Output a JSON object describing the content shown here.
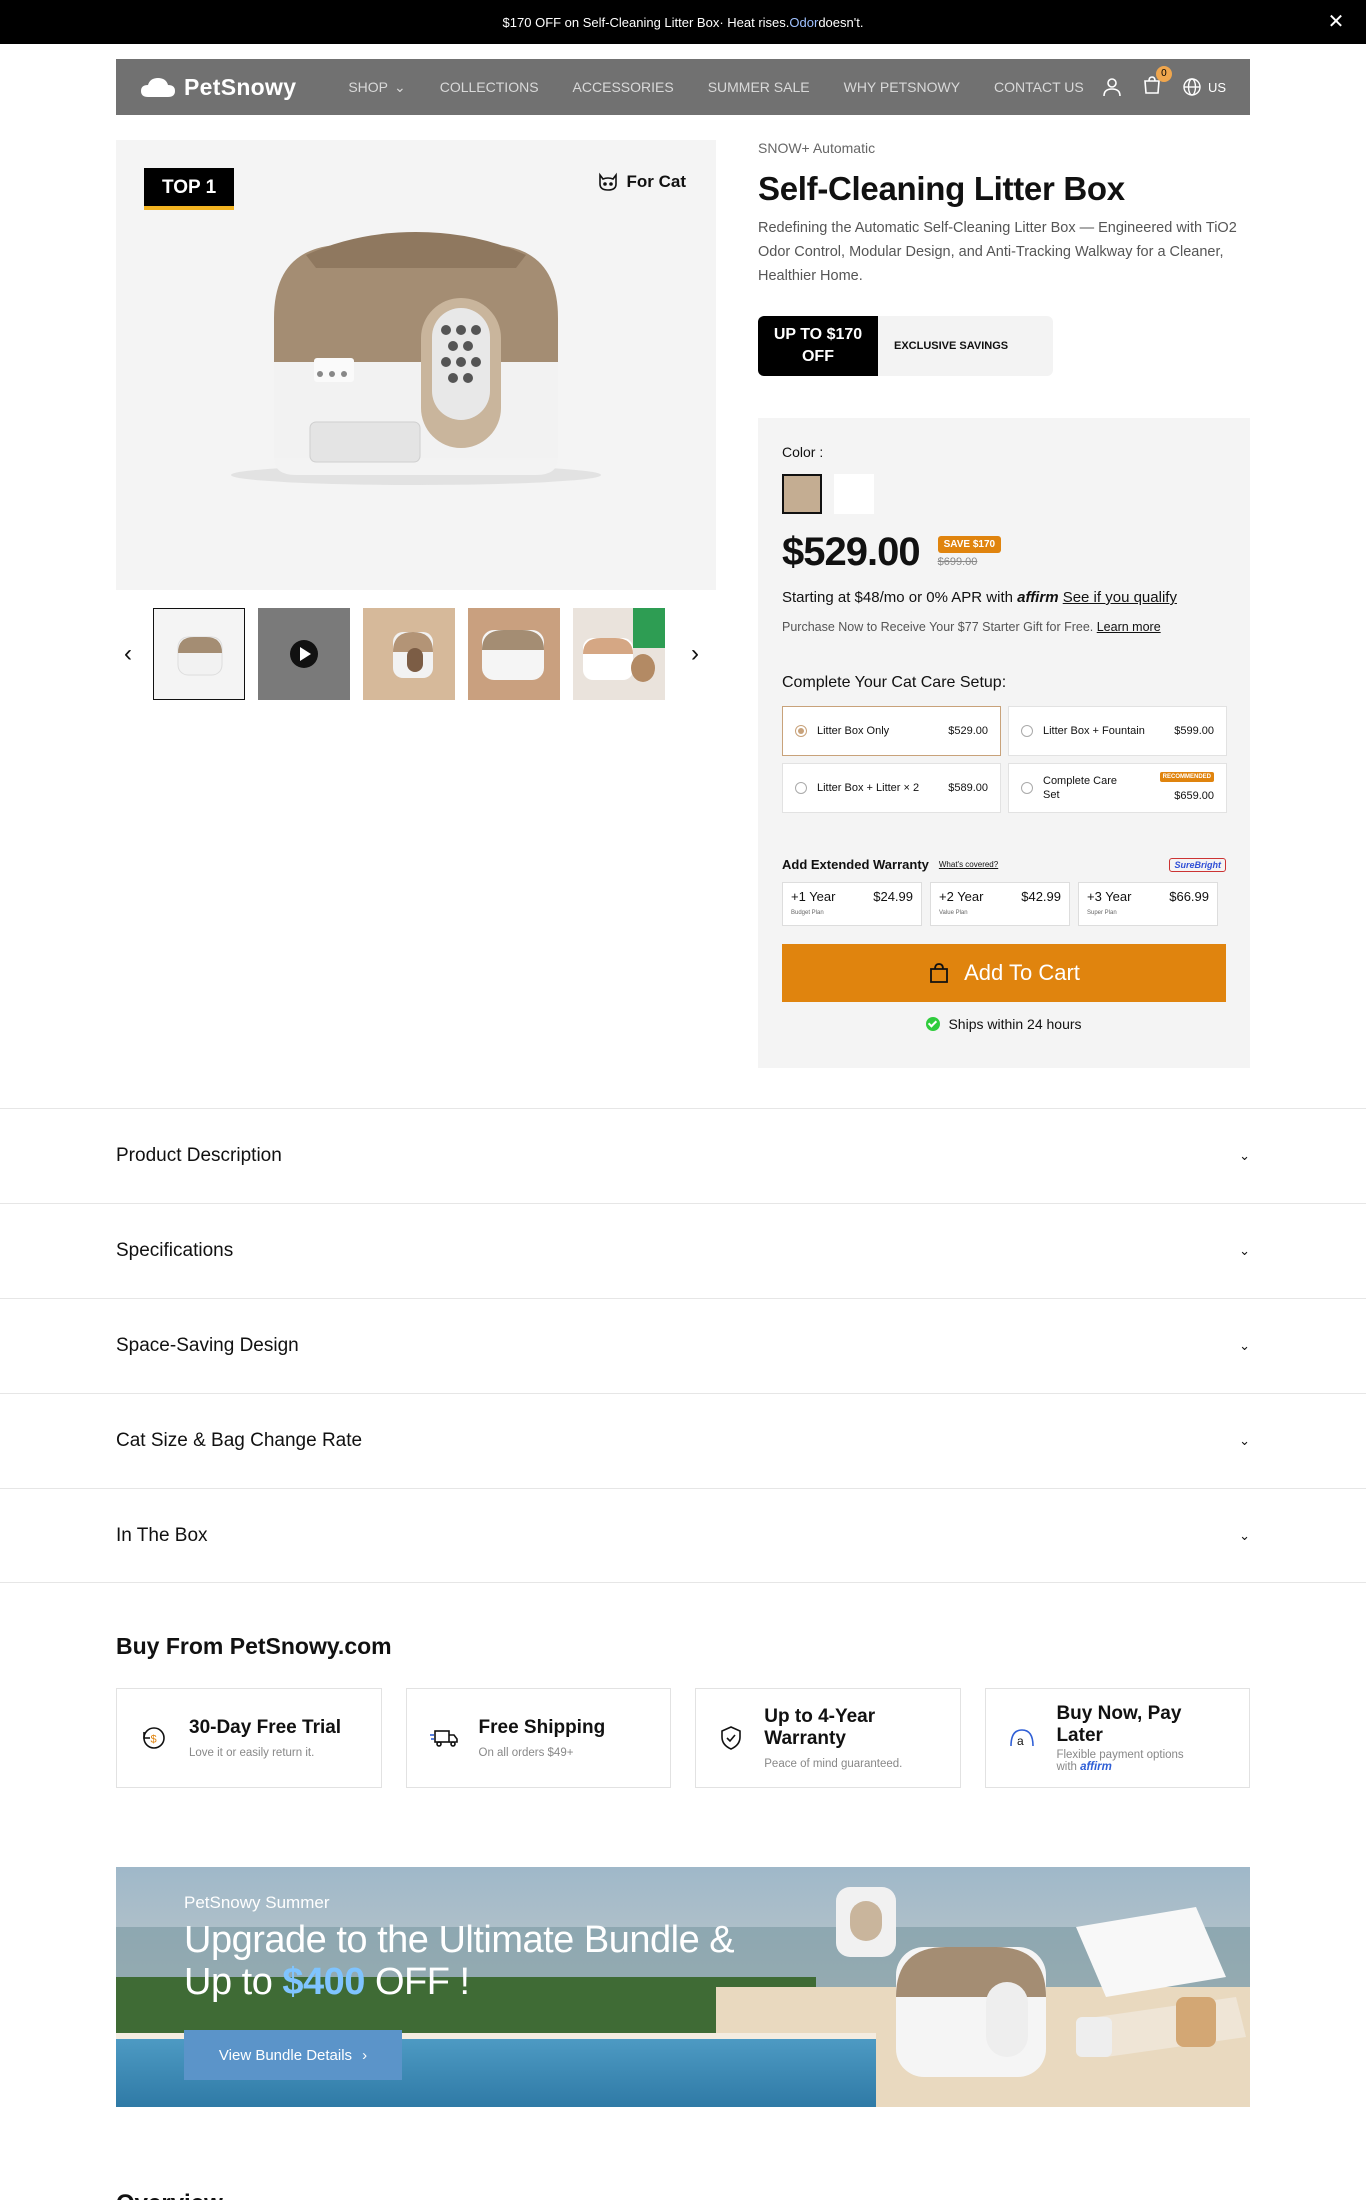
{
  "promo": {
    "text_1": "$170 OFF on Self-Cleaning Litter Box",
    "text_2": " · Heat rises. ",
    "text_3": "Odor",
    "text_4": " doesn't."
  },
  "nav": {
    "brand": "PetSnowy",
    "links": [
      "SHOP",
      "COLLECTIONS",
      "ACCESSORIES",
      "SUMMER SALE",
      "WHY PETSNOWY",
      "CONTACT US"
    ],
    "cart_count": "0",
    "lang": "US"
  },
  "hero": {
    "badge": "TOP 1",
    "for_cat": "For Cat"
  },
  "product": {
    "crumb": "SNOW+ Automatic",
    "title": "Self-Cleaning Litter Box",
    "desc": "Redefining the Automatic Self-Cleaning Litter Box — Engineered with TiO2 Odor Control, Modular Design, and Anti-Tracking Walkway for a Cleaner, Healthier Home.",
    "save_badge_1": "UP TO $170",
    "save_badge_2": "OFF",
    "save_label": "EXCLUSIVE SAVINGS"
  },
  "panel": {
    "color_label": "Color :",
    "colors": [
      "#c4ad92",
      "#ffffff"
    ],
    "price": "$529.00",
    "save_pill": "SAVE $170",
    "old_price": "$699.00",
    "affirm_1": "Starting at $48/mo or 0% APR with ",
    "affirm_brand": "affirm",
    "affirm_link": "See if you qualify",
    "gift": "Purchase Now to Receive Your $77 Starter Gift for Free. ",
    "gift_link": "Learn more",
    "setup_label": "Complete Your Cat Care Setup:",
    "options": [
      {
        "name": "Litter Box Only",
        "price": "$529.00"
      },
      {
        "name": "Litter Box + Fountain",
        "price": "$599.00"
      },
      {
        "name": "Litter Box + Litter × 2",
        "price": "$589.00"
      },
      {
        "name": "Complete Care Set",
        "price": "$659.00",
        "badge": "RECOMMENDED"
      }
    ],
    "warranty_label": "Add Extended Warranty",
    "warranty_link": "What's covered?",
    "warranty_brand": "SureBright",
    "warranties": [
      {
        "name": "+1 Year",
        "price": "$24.99",
        "plan": "Budget Plan"
      },
      {
        "name": "+2 Year",
        "price": "$42.99",
        "plan": "Value Plan"
      },
      {
        "name": "+3 Year",
        "price": "$66.99",
        "plan": "Super Plan"
      }
    ],
    "add_to_cart": "Add To Cart",
    "ships": "Ships within 24 hours"
  },
  "accordion": [
    "Product Description",
    "Specifications",
    "Space-Saving Design",
    "Cat Size & Bag Change Rate",
    "In The Box"
  ],
  "buy": {
    "title": "Buy From PetSnowy.com",
    "features": [
      {
        "title": "30-Day Free Trial",
        "sub": "Love it or easily return it.",
        "icon": "return-icon"
      },
      {
        "title": "Free Shipping",
        "sub": "On all orders $49+",
        "icon": "truck-icon"
      },
      {
        "title": "Up to 4-Year Warranty",
        "sub": "Peace of mind guaranteed.",
        "icon": "shield-icon"
      },
      {
        "title": "Buy Now, Pay Later",
        "sub": "Flexible payment options",
        "sub2": "with ",
        "sub3": "affirm",
        "icon": "affirm-icon"
      }
    ]
  },
  "banner": {
    "sub": "PetSnowy Summer",
    "head_1": "Upgrade to the Ultimate Bundle &",
    "head_2": "Up to ",
    "head_3": "$400",
    "head_4": " OFF !",
    "button": "View Bundle Details",
    "button_arrow": "›"
  },
  "next": {
    "title": "Overview"
  }
}
